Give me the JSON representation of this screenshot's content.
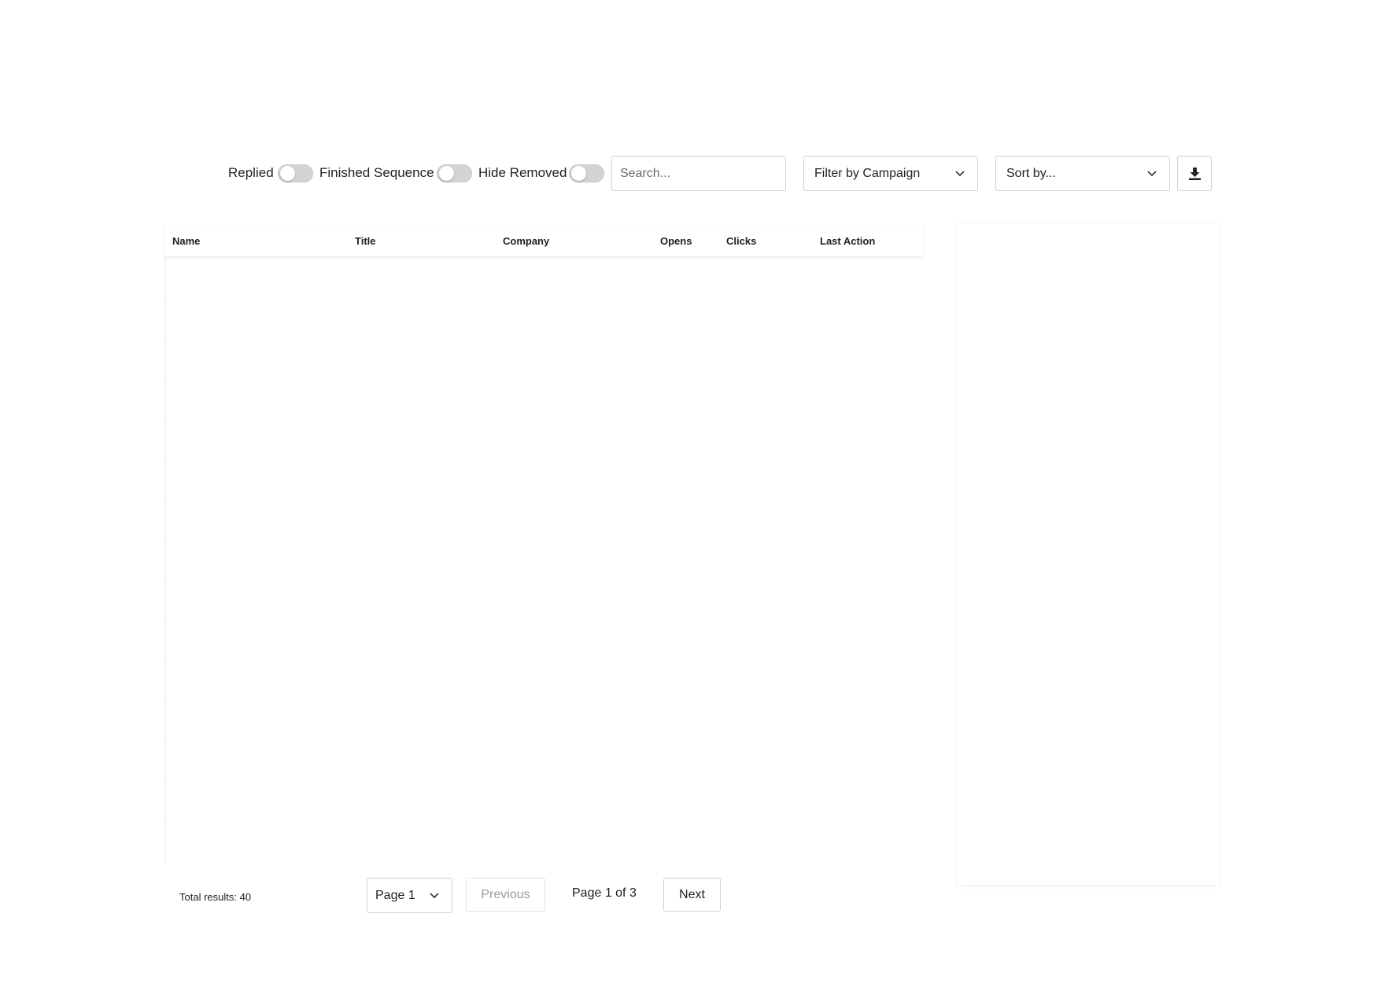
{
  "filters": {
    "toggles": [
      {
        "label": "Replied",
        "on": false
      },
      {
        "label": "Finished Sequence",
        "on": false
      },
      {
        "label": "Hide Removed",
        "on": false
      }
    ],
    "search_placeholder": "Search...",
    "campaign_select": "Filter by Campaign",
    "sort_select": "Sort by...",
    "download_icon": "download-icon"
  },
  "table": {
    "columns": [
      "Name",
      "Title",
      "Company",
      "Opens",
      "Clicks",
      "Last Action"
    ],
    "rows": []
  },
  "pagination": {
    "total_results": "Total results: 40",
    "page_select": "Page 1",
    "previous_label": "Previous",
    "page_info": "Page 1 of 3",
    "next_label": "Next"
  }
}
